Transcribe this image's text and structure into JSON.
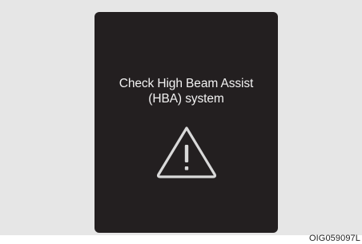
{
  "display": {
    "message_line1": "Check High Beam Assist",
    "message_line2": "(HBA) system",
    "icon": "warning-triangle-icon",
    "background_color": "#231f20",
    "text_color": "#f2f2f2"
  },
  "figure_code": "OIG059097L"
}
